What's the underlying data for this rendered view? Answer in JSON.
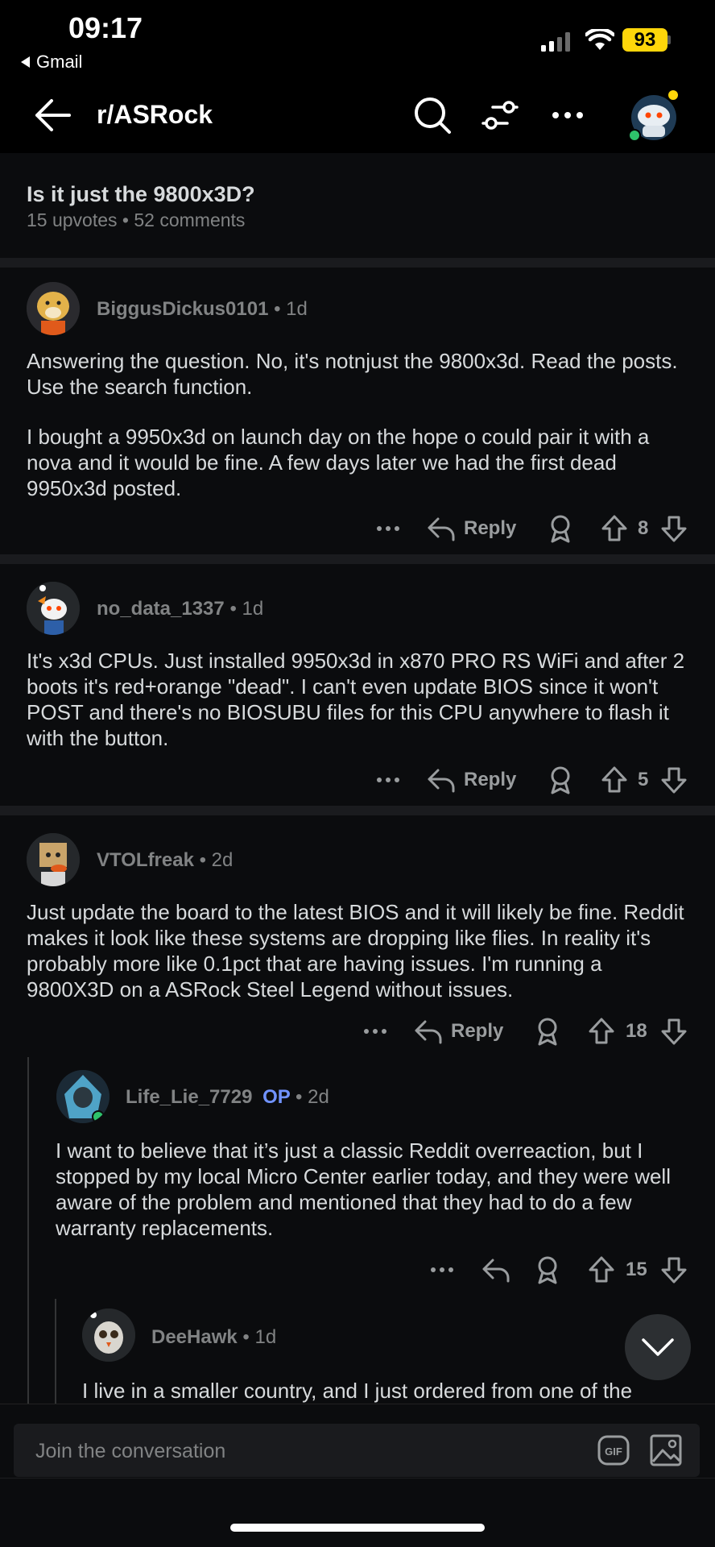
{
  "status_bar": {
    "time": "09:17",
    "back_app": "Gmail",
    "battery": "93"
  },
  "nav": {
    "title": "r/ASRock"
  },
  "post": {
    "title": "Is it just the 9800x3D?",
    "meta": "15 upvotes • 52 comments"
  },
  "comments": [
    {
      "user": "BiggusDickus0101",
      "age": "• 1d",
      "body": [
        "Answering the question. No, it's notnjust the 9800x3d. Read the posts. Use the search function.",
        "I bought a 9950x3d on launch day on the hope o could pair it with a nova and it would be fine. A few days later we had the first dead 9950x3d posted."
      ],
      "reply_label": "Reply",
      "score": "8"
    },
    {
      "user": "no_data_1337",
      "age": "• 1d",
      "body": [
        "It's x3d CPUs. Just installed 9950x3d in x870 PRO RS WiFi and after 2 boots it's red+orange \"dead\". I can't even update BIOS since it won't POST and there's no BIOSUBU files for this CPU anywhere to flash it with the button."
      ],
      "reply_label": "Reply",
      "score": "5"
    },
    {
      "user": "VTOLfreak",
      "age": "• 2d",
      "body": [
        "Just update the board to the latest BIOS and it will likely be fine. Reddit makes it look like these systems are dropping like flies. In reality it's probably more like 0.1pct that are having issues. I'm running a 9800X3D on a ASRock Steel Legend without issues."
      ],
      "reply_label": "Reply",
      "score": "18"
    },
    {
      "user": "Life_Lie_7729",
      "op_badge": "OP",
      "age": "• 2d",
      "body": [
        "I want to believe that it’s just a classic Reddit overreaction, but I stopped by my local Micro Center earlier today, and they were well aware of the problem and mentioned that they had to do a few warranty replacements."
      ],
      "score": "15"
    },
    {
      "user": "DeeHawk",
      "age": "• 1d",
      "body": [
        "I live in a smaller country, and I just ordered from one of the"
      ]
    }
  ],
  "composer": {
    "placeholder": "Join the conversation",
    "gif_label": "GIF"
  },
  "colors": {
    "background": "#0b0c0e",
    "separator": "#1a1b1e",
    "text": "#d7dadc",
    "meta": "#818384",
    "op": "#7193ff",
    "battery": "#ffd60a"
  }
}
